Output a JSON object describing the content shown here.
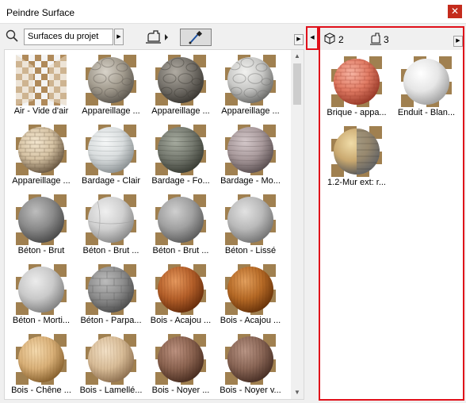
{
  "window": {
    "title": "Peindre Surface",
    "close_icon": "close-icon"
  },
  "toolbar": {
    "search_icon": "search-icon",
    "source_value": "Surfaces du projet",
    "brush_icon": "paint-brush-icon",
    "picker_icon": "eyedropper-icon"
  },
  "surfaces": [
    {
      "label": "Air - Vide d'air",
      "kind": "air"
    },
    {
      "label": "Appareillage ...",
      "kind": "stone1"
    },
    {
      "label": "Appareillage ...",
      "kind": "stone2"
    },
    {
      "label": "Appareillage ...",
      "kind": "stone3"
    },
    {
      "label": "Appareillage ...",
      "kind": "brickcream"
    },
    {
      "label": "Bardage - Clair",
      "kind": "siding_light"
    },
    {
      "label": "Bardage - Fo...",
      "kind": "siding_dark"
    },
    {
      "label": "Bardage - Mo...",
      "kind": "siding_mauve"
    },
    {
      "label": "Béton - Brut",
      "kind": "concrete_dark"
    },
    {
      "label": "Béton - Brut ...",
      "kind": "concrete_seam"
    },
    {
      "label": "Béton - Brut ...",
      "kind": "concrete_mid"
    },
    {
      "label": "Béton - Lissé",
      "kind": "concrete_light"
    },
    {
      "label": "Béton - Morti...",
      "kind": "concrete_pale"
    },
    {
      "label": "Béton - Parpa...",
      "kind": "block"
    },
    {
      "label": "Bois - Acajou ...",
      "kind": "mahogany"
    },
    {
      "label": "Bois - Acajou ...",
      "kind": "mahogany2"
    },
    {
      "label": "Bois - Chêne ...",
      "kind": "oak"
    },
    {
      "label": "Bois - Lamellé...",
      "kind": "lamelle"
    },
    {
      "label": "Bois - Noyer ...",
      "kind": "walnut"
    },
    {
      "label": "Bois - Noyer v...",
      "kind": "walnut2"
    }
  ],
  "right_panel": {
    "cube_icon": "cube-icon",
    "count_surfaces": "2",
    "brush_icon": "paint-brush-icon",
    "count_painted": "3",
    "items": [
      {
        "label": "Brique - appa...",
        "kind": "brickred"
      },
      {
        "label": "Enduit - Blan...",
        "kind": "plaster"
      },
      {
        "label": "1.2-Mur ext: r...",
        "kind": "composite"
      }
    ]
  },
  "colors": {
    "accent_red": "#e0101a",
    "close_red": "#c42b1c"
  }
}
